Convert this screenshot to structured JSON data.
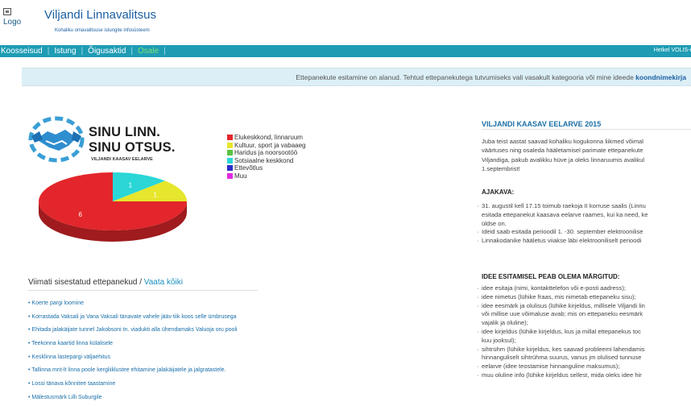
{
  "header": {
    "logo_alt": "Logo",
    "title": "Viljandi Linnavalitsus",
    "subtitle": "Kohaliku omavalitsuse istungite infosüsteem"
  },
  "nav": {
    "items": [
      {
        "label": "Koosseisud",
        "active": false
      },
      {
        "label": "Istung",
        "active": false
      },
      {
        "label": "Õigusaktid",
        "active": false
      },
      {
        "label": "Osale",
        "active": true
      }
    ],
    "right_text": "Hetkel VOLIS-i"
  },
  "banner": {
    "text": "Ettepanekute esitamine on alanud. Tehtud ettepanekutega tutvumiseks vali vasakult kategooria või mine ideede ",
    "link": "koondnimekirja"
  },
  "campaign": {
    "slogan_line1": "SINU LINN.",
    "slogan_line2": "SINU OTSUS.",
    "slogan_sub": "VILJANDI KAASAV EELARVE"
  },
  "chart_data": {
    "type": "pie",
    "categories": [
      "Elukeskkond, linnaruum",
      "Kultuur, sport ja vabaaeg",
      "Haridus ja noorsootöö",
      "Sotsiaalne keskkond",
      "Ettevõtlus",
      "Muu"
    ],
    "values": [
      6,
      1,
      0,
      1,
      0,
      0
    ],
    "colors": [
      "#e3262b",
      "#e6e62c",
      "#5bc246",
      "#2ad6d6",
      "#2c2cc8",
      "#e22ae2"
    ],
    "legend_position": "right"
  },
  "latest": {
    "title": "Viimati sisestatud ettepanekud / ",
    "view_all": "Vaata kõiki",
    "items": [
      "Koerte pargi loomine",
      "Korrastada Vaksali ja Vana Vaksali tänavate vahele jääv tiik koos selle ümbrusega",
      "Ehitada jalakäijate tunnel Jakobsoni tn. viadukti alla ühendamaks Valuoja oru pooli",
      "Teekonna kaartid linna külalisele",
      "Kesklinna lastepargi väljaehitus",
      "Tallinna mnt-lt linna poole kergliiklustee ehitamine jalakäijatele ja jalgratastele.",
      "Lossi tänava kõnnitee taastamine",
      "Mälestusmärk Lilli Suburgile"
    ]
  },
  "info": {
    "title": "VILJANDI KAASAV EELARVE 2015",
    "paragraph_lines": [
      "Juba teist aastat saavad kohaliku kogukonna liikmed võimal",
      "väärtuses ning osaleda hääletamisel parimate ettepanekute",
      "Viljandiga, pakub avalikku hüve ja oleks linnaruumis avalikul",
      "1.septembrist!"
    ],
    "schedule_title": "AJAKAVA:",
    "schedule": [
      [
        "31. augustil kell 17.15 toimub raekoja II korruse saalis (Linnu",
        "esitada ettepanekut kaasava eelarve raames, kui ka need, ke",
        "üldse on."
      ],
      [
        "Ideid saab esitada perioodil 1. -30. september elektroonilise"
      ],
      [
        "Linnakodanike hääletus viiakse läbi elektrooniliselt perioodi"
      ]
    ],
    "requirements_title": "IDEE ESITAMISEL PEAB OLEMA MÄRGITUD:",
    "requirements": [
      [
        "idee esitaja (nimi, kontakttelefon või e-posti aadress);"
      ],
      [
        "idee nimetus (lühike fraas, mis nimetab ettepaneku sisu);"
      ],
      [
        "idee eesmärk ja olulisus (lühike kirjeldus, millisele Viljandi lin",
        "või millise uue võimaluse avab; mis on ettepaneku eesmärk",
        "vajalik ja oluline);"
      ],
      [
        "idee kirjeldus (lühike kirjeldus, kus ja millal ettepanekus toc",
        "kuu jooksul);"
      ],
      [
        "sihtrühm (lühike kirjeldus, kes saavad probleemi lahendamis",
        "hinnanguliselt sihtrühma suurus, vanus jm olulised tunnuse"
      ],
      [
        "eelarve (idee teostamise hinnanguline maksumus);"
      ],
      [
        "muu oluline info (lühike kirjeldus sellest, mida oleks idee hir"
      ]
    ]
  }
}
